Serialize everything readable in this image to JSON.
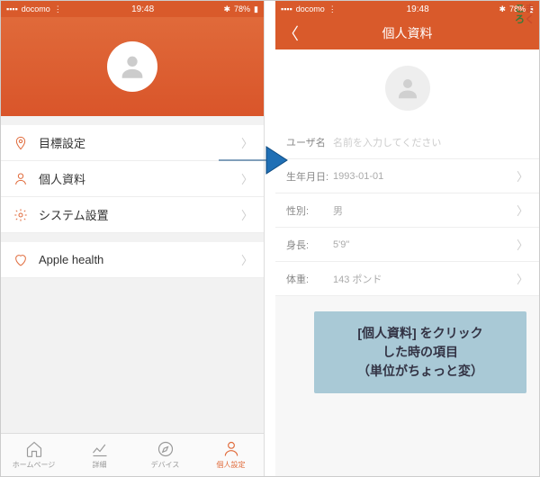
{
  "status": {
    "carrier": "docomo",
    "time": "19:48",
    "battery": "78%"
  },
  "left": {
    "menu": [
      {
        "label": "目標設定"
      },
      {
        "label": "個人資料"
      },
      {
        "label": "システム設置"
      },
      {
        "label": "Apple health"
      }
    ],
    "tabs": [
      {
        "label": "ホームページ"
      },
      {
        "label": "詳細"
      },
      {
        "label": "デバイス"
      },
      {
        "label": "個人設定"
      }
    ]
  },
  "right": {
    "title": "個人資料",
    "rows": [
      {
        "label": "ユーザ名",
        "placeholder": "名前を入力してください"
      },
      {
        "label": "生年月日:",
        "value": "1993-01-01"
      },
      {
        "label": "性別:",
        "value": "男"
      },
      {
        "label": "身長:",
        "value": "5'9\""
      },
      {
        "label": "体重:",
        "value": "143 ポンド"
      }
    ]
  },
  "callout": {
    "line1": "[個人資料] をクリック",
    "line2": "した時の項目",
    "line3": "（単位がちょっと変）"
  },
  "watermark": {
    "a": "こま",
    "b": "ろく"
  }
}
